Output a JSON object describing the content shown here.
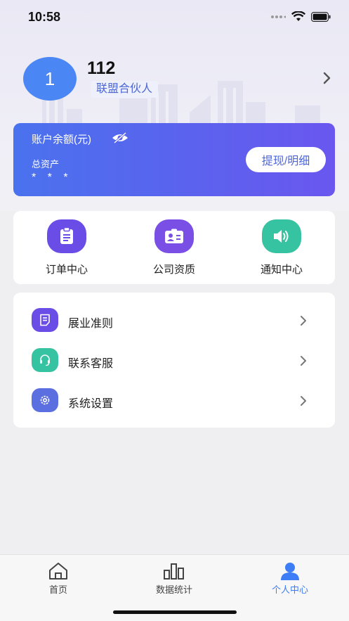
{
  "status_bar": {
    "time": "10:58"
  },
  "profile": {
    "avatar_text": "1",
    "name": "112",
    "tag": "联盟合伙人"
  },
  "balance": {
    "title": "账户余额(元)",
    "assets_label": "总资产",
    "assets_value": "* * *",
    "withdraw_label": "提现/明细"
  },
  "quick_actions": [
    {
      "label": "订单中心",
      "icon": "clipboard-icon",
      "color": "#6a4de6"
    },
    {
      "label": "公司资质",
      "icon": "id-card-icon",
      "color": "#7a4fe6"
    },
    {
      "label": "通知中心",
      "icon": "speaker-icon",
      "color": "#35c3a1"
    }
  ],
  "menu": [
    {
      "label": "展业准则",
      "icon": "document-icon",
      "color": "#6a4de6"
    },
    {
      "label": "联系客服",
      "icon": "headset-icon",
      "color": "#35c3a1"
    },
    {
      "label": "系统设置",
      "icon": "gear-icon",
      "color": "#5b6fe0"
    }
  ],
  "tabs": [
    {
      "label": "首页",
      "icon": "home-icon"
    },
    {
      "label": "数据统计",
      "icon": "bar-chart-icon"
    },
    {
      "label": "个人中心",
      "icon": "person-icon",
      "active": true
    }
  ],
  "colors": {
    "accent": "#3d7df6",
    "card_start": "#4a72ee",
    "card_end": "#6a57ef"
  }
}
